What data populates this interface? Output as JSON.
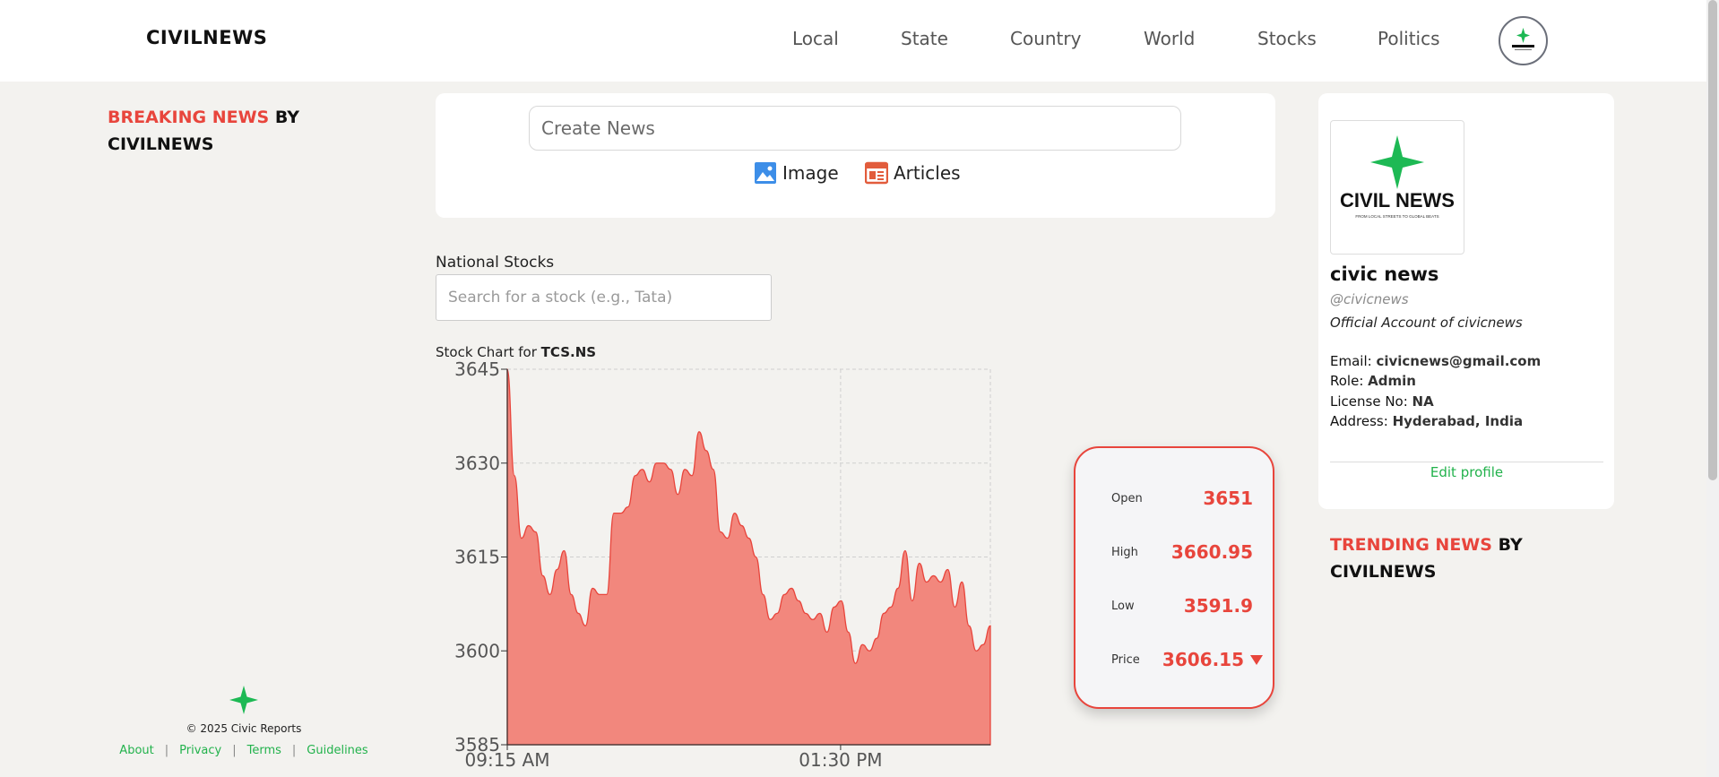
{
  "header": {
    "brand": "CIVILNEWS",
    "nav": [
      "Local",
      "State",
      "Country",
      "World",
      "Stocks",
      "Politics"
    ]
  },
  "breaking": {
    "highlight": "BREAKING NEWS",
    "rest": " BY",
    "line2": "CIVILNEWS"
  },
  "trending": {
    "highlight": "TRENDING NEWS",
    "rest": " BY",
    "line2": "CIVILNEWS"
  },
  "create": {
    "placeholder": "Create News",
    "image_label": "Image",
    "articles_label": "Articles"
  },
  "stocks": {
    "label": "National Stocks",
    "search_placeholder": "Search for a stock (e.g., Tata)",
    "chart_title_prefix": "Stock Chart for ",
    "symbol": "TCS.NS"
  },
  "quote": {
    "open_label": "Open",
    "open": "3651",
    "high_label": "High",
    "high": "3660.95",
    "low_label": "Low",
    "low": "3591.9",
    "price_label": "Price",
    "price": "3606.15"
  },
  "profile": {
    "logo_text": "CIVIL NEWS",
    "logo_tagline": "FROM LOCAL STREETS TO GLOBAL BEATS",
    "name": "civic news",
    "handle": "@civicnews",
    "description": "Official Account of civicnews",
    "email_label": "Email: ",
    "email": "civicnews@gmail.com",
    "role_label": "Role: ",
    "role": "Admin",
    "license_label": "License No: ",
    "license": "NA",
    "address_label": "Address: ",
    "address": "Hyderabad, India",
    "edit_label": "Edit profile"
  },
  "footer": {
    "copyright": "© 2025 Civic Reports",
    "links": [
      "About",
      "Privacy",
      "Terms",
      "Guidelines"
    ]
  },
  "colors": {
    "accent_red": "#e8453c",
    "brand_green": "#1db954",
    "area_fill": "#f2877d"
  },
  "chart_data": {
    "type": "area",
    "ylim": [
      3585,
      3645
    ],
    "yticks": [
      3585,
      3600,
      3615,
      3630,
      3645
    ],
    "ytick_labels": [
      "3585",
      "3600",
      "3615",
      "3630",
      "3645"
    ],
    "xtick_labels": [
      "09:15 AM",
      "01:30 PM"
    ],
    "xtick_positions": [
      0,
      0.69
    ],
    "grid": true,
    "values": [
      3645,
      3628,
      3618,
      3620,
      3619,
      3612,
      3609,
      3613,
      3616,
      3609,
      3606,
      3604,
      3610,
      3609,
      3609,
      3622,
      3622,
      3623,
      3628,
      3629,
      3627,
      3630,
      3630,
      3629,
      3625,
      3629,
      3628,
      3635,
      3632,
      3629,
      3619,
      3618,
      3622,
      3620,
      3618,
      3615,
      3609,
      3605,
      3606,
      3609,
      3610,
      3608,
      3606,
      3605,
      3606,
      3603,
      3607,
      3608,
      3603,
      3598,
      3601,
      3600,
      3602,
      3606,
      3607,
      3610,
      3616,
      3608,
      3614,
      3611,
      3612,
      3611,
      3613,
      3607,
      3611,
      3604,
      3600,
      3601,
      3604
    ]
  }
}
